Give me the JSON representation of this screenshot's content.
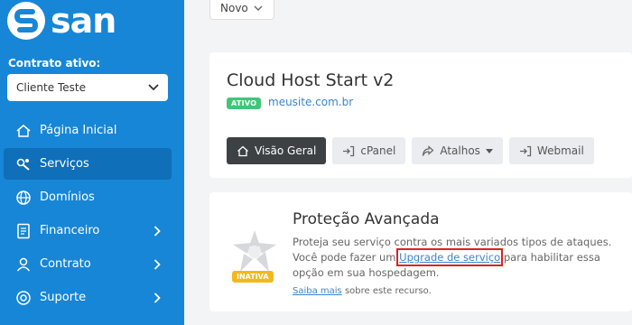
{
  "brand": {
    "name": "san"
  },
  "sidebar": {
    "contract_label": "Contrato ativo:",
    "contract_value": "Cliente Teste",
    "items": [
      {
        "label": "Página Inicial",
        "icon": "home-icon",
        "has_submenu": false
      },
      {
        "label": "Serviços",
        "icon": "services-icon",
        "has_submenu": false,
        "active": true
      },
      {
        "label": "Domínios",
        "icon": "globe-icon",
        "has_submenu": false
      },
      {
        "label": "Financeiro",
        "icon": "invoice-icon",
        "has_submenu": true
      },
      {
        "label": "Contrato",
        "icon": "user-icon",
        "has_submenu": true
      },
      {
        "label": "Suporte",
        "icon": "help-icon",
        "has_submenu": true
      }
    ]
  },
  "topbar": {
    "new_label": "Novo"
  },
  "service": {
    "title": "Cloud Host Start v2",
    "status": "ATIVO",
    "domain": "meusite.com.br",
    "actions": [
      {
        "label": "Visão Geral",
        "icon": "home-icon"
      },
      {
        "label": "cPanel",
        "icon": "login-icon"
      },
      {
        "label": "Atalhos",
        "icon": "share-icon"
      },
      {
        "label": "Webmail",
        "icon": "login-icon"
      }
    ]
  },
  "protection": {
    "title": "Proteção Avançada",
    "status": "INATIVA",
    "text_1": "Proteja seu serviço contra os mais variados tipos de ataques. Você pode fazer um ",
    "link_upgrade": "Upgrade de serviço",
    "text_2": " para habilitar essa opção em sua hospedagem.",
    "learn_link": "Saiba mais",
    "learn_text": " sobre este recurso."
  },
  "colors": {
    "sidebar": "#1786d6",
    "active_badge": "#3fc679",
    "inactive_badge": "#f2b81e",
    "link": "#3c85c9",
    "highlight": "#e02020"
  }
}
